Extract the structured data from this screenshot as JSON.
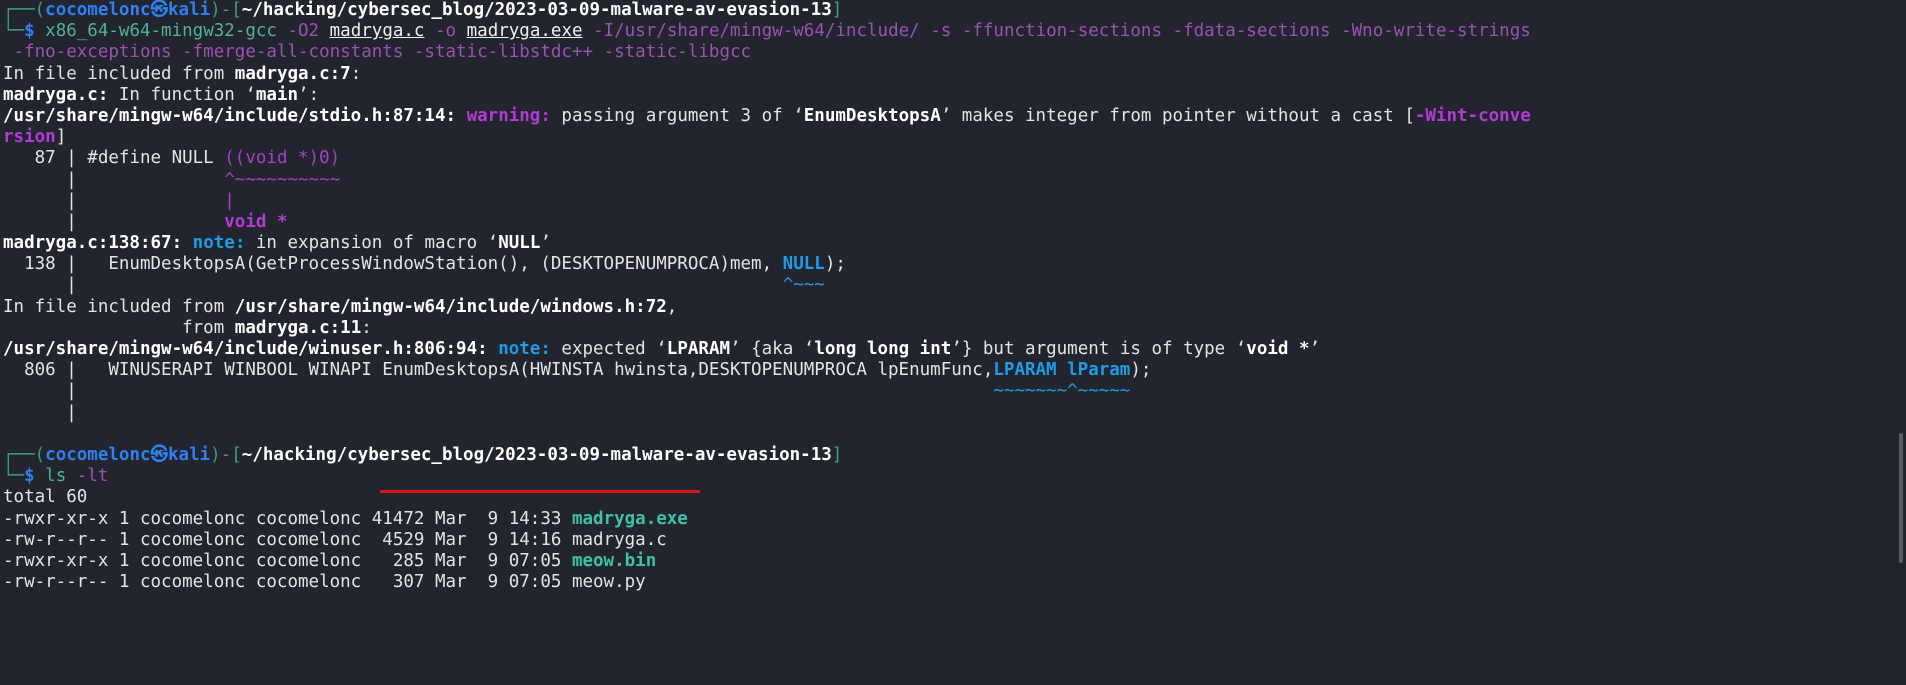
{
  "terminal": {
    "colors": {
      "background": "#22252e",
      "prompt_user": "#2f80f0",
      "frame": "#3c9d83",
      "command": "#4fb39c",
      "option": "#9a52b3",
      "warning": "#b23ad6",
      "note": "#1e9ce8",
      "executable": "#3fc1a3",
      "annotation_underline": "#e0141a"
    },
    "lines": [
      [
        [
          "frame",
          "┌──("
        ],
        [
          "user",
          "cocomelonc㉿kali"
        ],
        [
          "frame",
          ")-["
        ],
        [
          "path",
          "~/hacking/cybersec_blog/2023-03-09-malware-av-evasion-13"
        ],
        [
          "frame",
          "]"
        ]
      ],
      [
        [
          "frame",
          "└─"
        ],
        [
          "dollar",
          "$"
        ],
        [
          "cmd",
          " x86_64-w64-mingw32-gcc"
        ],
        [
          "opt",
          " -O2 "
        ],
        [
          "arg",
          "madryga.c"
        ],
        [
          "opt",
          " -o "
        ],
        [
          "arg",
          "madryga.exe"
        ],
        [
          "opt",
          " -I/usr/share/mingw-w64/include/ -s -ffunction-sections -fdata-sections -Wno-write-strings"
        ]
      ],
      [
        [
          "opt",
          " -fno-exceptions -fmerge-all-constants -static-libstdc++ -static-libgcc"
        ]
      ],
      [
        [
          "text",
          "In file included from "
        ],
        [
          "bold",
          "madryga.c:7"
        ],
        [
          "text",
          ":"
        ]
      ],
      [
        [
          "bold",
          "madryga.c:"
        ],
        [
          "text",
          " In function ‘"
        ],
        [
          "bold",
          "main"
        ],
        [
          "text",
          "’:"
        ]
      ],
      [
        [
          "bold",
          "/usr/share/mingw-w64/include/stdio.h:87:14:"
        ],
        [
          "text",
          " "
        ],
        [
          "warn",
          "warning:"
        ],
        [
          "text",
          " passing argument 3 of ‘"
        ],
        [
          "bold",
          "EnumDesktopsA"
        ],
        [
          "text",
          "’ makes integer from pointer without a cast ["
        ],
        [
          "warn",
          "-Wint-conve"
        ]
      ],
      [
        [
          "warn",
          "rsion"
        ],
        [
          "text",
          "]"
        ]
      ],
      [
        [
          "text",
          "   87 | #define NULL "
        ],
        [
          "magenta",
          "((void *)0)"
        ]
      ],
      [
        [
          "text",
          "      |              "
        ],
        [
          "magenta",
          "^~~~~~~~~~~"
        ]
      ],
      [
        [
          "text",
          "      |              "
        ],
        [
          "magenta",
          "|"
        ]
      ],
      [
        [
          "text",
          "      |              "
        ],
        [
          "warn",
          "void *"
        ]
      ],
      [
        [
          "bold",
          "madryga.c:138:67:"
        ],
        [
          "text",
          " "
        ],
        [
          "note",
          "note:"
        ],
        [
          "text",
          " in expansion of macro ‘"
        ],
        [
          "bold",
          "NULL"
        ],
        [
          "text",
          "’"
        ]
      ],
      [
        [
          "text",
          "  138 |   EnumDesktopsA(GetProcessWindowStation(), (DESKTOPENUMPROCA)mem, "
        ],
        [
          "note",
          "NULL"
        ],
        [
          "text",
          ");"
        ]
      ],
      [
        [
          "text",
          "      |                                                                   "
        ],
        [
          "notec",
          "^~~~"
        ]
      ],
      [
        [
          "text",
          "In file included from "
        ],
        [
          "bold",
          "/usr/share/mingw-w64/include/windows.h:72"
        ],
        [
          "text",
          ","
        ]
      ],
      [
        [
          "text",
          "                 from "
        ],
        [
          "bold",
          "madryga.c:11"
        ],
        [
          "text",
          ":"
        ]
      ],
      [
        [
          "bold",
          "/usr/share/mingw-w64/include/winuser.h:806:94:"
        ],
        [
          "text",
          " "
        ],
        [
          "note",
          "note:"
        ],
        [
          "text",
          " expected ‘"
        ],
        [
          "bold",
          "LPARAM"
        ],
        [
          "text",
          "’ {aka ‘"
        ],
        [
          "bold",
          "long long int"
        ],
        [
          "text",
          "’} but argument is of type ‘"
        ],
        [
          "bold",
          "void *"
        ],
        [
          "text",
          "’"
        ]
      ],
      [
        [
          "text",
          "  806 |   WINUSERAPI WINBOOL WINAPI EnumDesktopsA(HWINSTA hwinsta,DESKTOPENUMPROCA lpEnumFunc,"
        ],
        [
          "note",
          "LPARAM lParam"
        ],
        [
          "text",
          ");"
        ]
      ],
      [
        [
          "text",
          "      |                                                                                       "
        ],
        [
          "notec",
          "~~~~~~~^~~~~~"
        ]
      ],
      [
        [
          "text",
          "      |"
        ]
      ],
      [
        [
          "text",
          ""
        ]
      ],
      [
        [
          "frame",
          "┌──("
        ],
        [
          "user",
          "cocomelonc㉿kali"
        ],
        [
          "frame",
          ")-["
        ],
        [
          "path",
          "~/hacking/cybersec_blog/2023-03-09-malware-av-evasion-13"
        ],
        [
          "frame",
          "]"
        ]
      ],
      [
        [
          "frame",
          "└─"
        ],
        [
          "dollar",
          "$"
        ],
        [
          "cmd",
          " ls"
        ],
        [
          "opt",
          " -lt"
        ]
      ],
      [
        [
          "text",
          "total 60"
        ]
      ],
      [
        [
          "text",
          "-rwxr-xr-x 1 cocomelonc cocomelonc 41472 Mar  9 14:33 "
        ],
        [
          "exe",
          "madryga.exe"
        ]
      ],
      [
        [
          "text",
          "-rw-r--r-- 1 cocomelonc cocomelonc  4529 Mar  9 14:16 madryga.c"
        ]
      ],
      [
        [
          "text",
          "-rwxr-xr-x 1 cocomelonc cocomelonc   285 Mar  9 07:05 "
        ],
        [
          "exe",
          "meow.bin"
        ]
      ],
      [
        [
          "text",
          "-rw-r--r-- 1 cocomelonc cocomelonc   307 Mar  9 07:05 meow.py"
        ]
      ]
    ]
  }
}
